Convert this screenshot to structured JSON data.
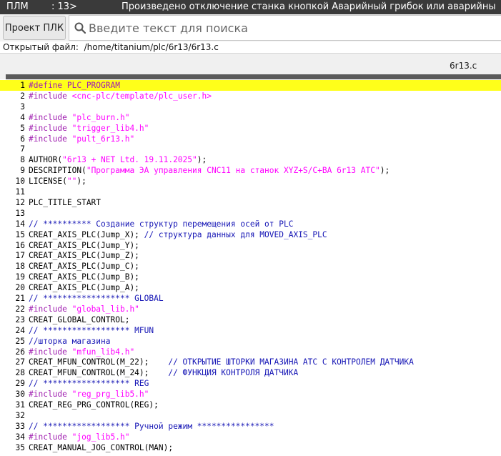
{
  "titlebar": {
    "app": "ПЛМ",
    "position": ": 13>",
    "message": "Произведено отключение станка кнопкой Аварийный грибок или аварийны"
  },
  "toolbar": {
    "project_button": "Проект ПЛК",
    "search_placeholder": "Введите текст для поиска",
    "search_icon": "magnifier-icon"
  },
  "file": {
    "label": "Открытый файл:",
    "path": "/home/titanium/plc/6r13/6r13.c"
  },
  "tab": {
    "name": "6r13.c"
  },
  "colors": {
    "highlight": "#ffff1a",
    "preprocessor": "#a020b0",
    "string": "#ff00ff",
    "comment": "#1515b5"
  },
  "editor": {
    "highlighted_line": 1,
    "lines": [
      {
        "n": "1",
        "parts": [
          {
            "t": "#define PLC_PROGRAM",
            "c": "pp"
          }
        ]
      },
      {
        "n": "2",
        "parts": [
          {
            "t": "#include ",
            "c": "pp"
          },
          {
            "t": "<cnc-plc/template/plc_user.h>",
            "c": "str"
          }
        ]
      },
      {
        "n": "3",
        "parts": []
      },
      {
        "n": "4",
        "parts": [
          {
            "t": "#include ",
            "c": "pp"
          },
          {
            "t": "\"plc_burn.h\"",
            "c": "str"
          }
        ]
      },
      {
        "n": "5",
        "parts": [
          {
            "t": "#include ",
            "c": "pp"
          },
          {
            "t": "\"trigger_lib4.h\"",
            "c": "str"
          }
        ]
      },
      {
        "n": "6",
        "parts": [
          {
            "t": "#include ",
            "c": "pp"
          },
          {
            "t": "\"pult_6r13.h\"",
            "c": "str"
          }
        ]
      },
      {
        "n": "7",
        "parts": []
      },
      {
        "n": "8",
        "parts": [
          {
            "t": "AUTHOR(",
            "c": "plain"
          },
          {
            "t": "\"6r13 + NET Ltd. 19.11.2025\"",
            "c": "str"
          },
          {
            "t": ");",
            "c": "plain"
          }
        ]
      },
      {
        "n": "9",
        "parts": [
          {
            "t": "DESCRIPTION(",
            "c": "plain"
          },
          {
            "t": "\"Программа ЭА управления CNC11 на станок XYZ+S/C+BA 6r13 ATC\"",
            "c": "str"
          },
          {
            "t": ");",
            "c": "plain"
          }
        ]
      },
      {
        "n": "10",
        "parts": [
          {
            "t": "LICENSE(",
            "c": "plain"
          },
          {
            "t": "\"\"",
            "c": "str"
          },
          {
            "t": ");",
            "c": "plain"
          }
        ]
      },
      {
        "n": "11",
        "parts": []
      },
      {
        "n": "12",
        "parts": [
          {
            "t": "PLC_TITLE_START",
            "c": "plain"
          }
        ]
      },
      {
        "n": "13",
        "parts": []
      },
      {
        "n": "14",
        "parts": [
          {
            "t": "// ********** Создание структур перемещения осей от PLC",
            "c": "cmt"
          }
        ]
      },
      {
        "n": "15",
        "parts": [
          {
            "t": "CREAT_AXIS_PLC(Jump_X); ",
            "c": "plain"
          },
          {
            "t": "// структура данных для MOVED_AXIS_PLC",
            "c": "cmt"
          }
        ]
      },
      {
        "n": "16",
        "parts": [
          {
            "t": "CREAT_AXIS_PLC(Jump_Y);",
            "c": "plain"
          }
        ]
      },
      {
        "n": "17",
        "parts": [
          {
            "t": "CREAT_AXIS_PLC(Jump_Z);",
            "c": "plain"
          }
        ]
      },
      {
        "n": "18",
        "parts": [
          {
            "t": "CREAT_AXIS_PLC(Jump_C);",
            "c": "plain"
          }
        ]
      },
      {
        "n": "19",
        "parts": [
          {
            "t": "CREAT_AXIS_PLC(Jump_B);",
            "c": "plain"
          }
        ]
      },
      {
        "n": "20",
        "parts": [
          {
            "t": "CREAT_AXIS_PLC(Jump_A);",
            "c": "plain"
          }
        ]
      },
      {
        "n": "21",
        "parts": [
          {
            "t": "// ****************** GLOBAL",
            "c": "cmt"
          }
        ]
      },
      {
        "n": "22",
        "parts": [
          {
            "t": "#include ",
            "c": "pp"
          },
          {
            "t": "\"global_lib.h\"",
            "c": "str"
          }
        ]
      },
      {
        "n": "23",
        "parts": [
          {
            "t": "CREAT_GLOBAL_CONTROL;",
            "c": "plain"
          }
        ]
      },
      {
        "n": "24",
        "parts": [
          {
            "t": "// ****************** MFUN",
            "c": "cmt"
          }
        ]
      },
      {
        "n": "25",
        "parts": [
          {
            "t": "//шторка магазина",
            "c": "cmt"
          }
        ]
      },
      {
        "n": "26",
        "parts": [
          {
            "t": "#include ",
            "c": "pp"
          },
          {
            "t": "\"mfun_lib4.h\"",
            "c": "str"
          }
        ]
      },
      {
        "n": "27",
        "parts": [
          {
            "t": "CREAT_MFUN_CONTROL(M_22);    ",
            "c": "plain"
          },
          {
            "t": "// ОТКРЫТИЕ ШТОРКИ МАГАЗИНА ATC С КОНТРОЛЕМ ДАТЧИКА",
            "c": "cmt"
          }
        ]
      },
      {
        "n": "28",
        "parts": [
          {
            "t": "CREAT_MFUN_CONTROL(M_24);    ",
            "c": "plain"
          },
          {
            "t": "// ФУНКЦИЯ КОНТРОЛЯ ДАТЧИКА",
            "c": "cmt"
          }
        ]
      },
      {
        "n": "29",
        "parts": [
          {
            "t": "// ****************** REG",
            "c": "cmt"
          }
        ]
      },
      {
        "n": "30",
        "parts": [
          {
            "t": "#include ",
            "c": "pp"
          },
          {
            "t": "\"reg_prg_lib5.h\"",
            "c": "str"
          }
        ]
      },
      {
        "n": "31",
        "parts": [
          {
            "t": "CREAT_REG_PRG_CONTROL(REG);",
            "c": "plain"
          }
        ]
      },
      {
        "n": "32",
        "parts": []
      },
      {
        "n": "33",
        "parts": [
          {
            "t": "// ****************** Ручной режим ****************",
            "c": "cmt"
          }
        ]
      },
      {
        "n": "34",
        "parts": [
          {
            "t": "#include ",
            "c": "pp"
          },
          {
            "t": "\"jog_lib5.h\"",
            "c": "str"
          }
        ]
      },
      {
        "n": "35",
        "parts": [
          {
            "t": "CREAT_MANUAL_JOG_CONTROL(MAN);",
            "c": "plain"
          }
        ]
      }
    ]
  }
}
